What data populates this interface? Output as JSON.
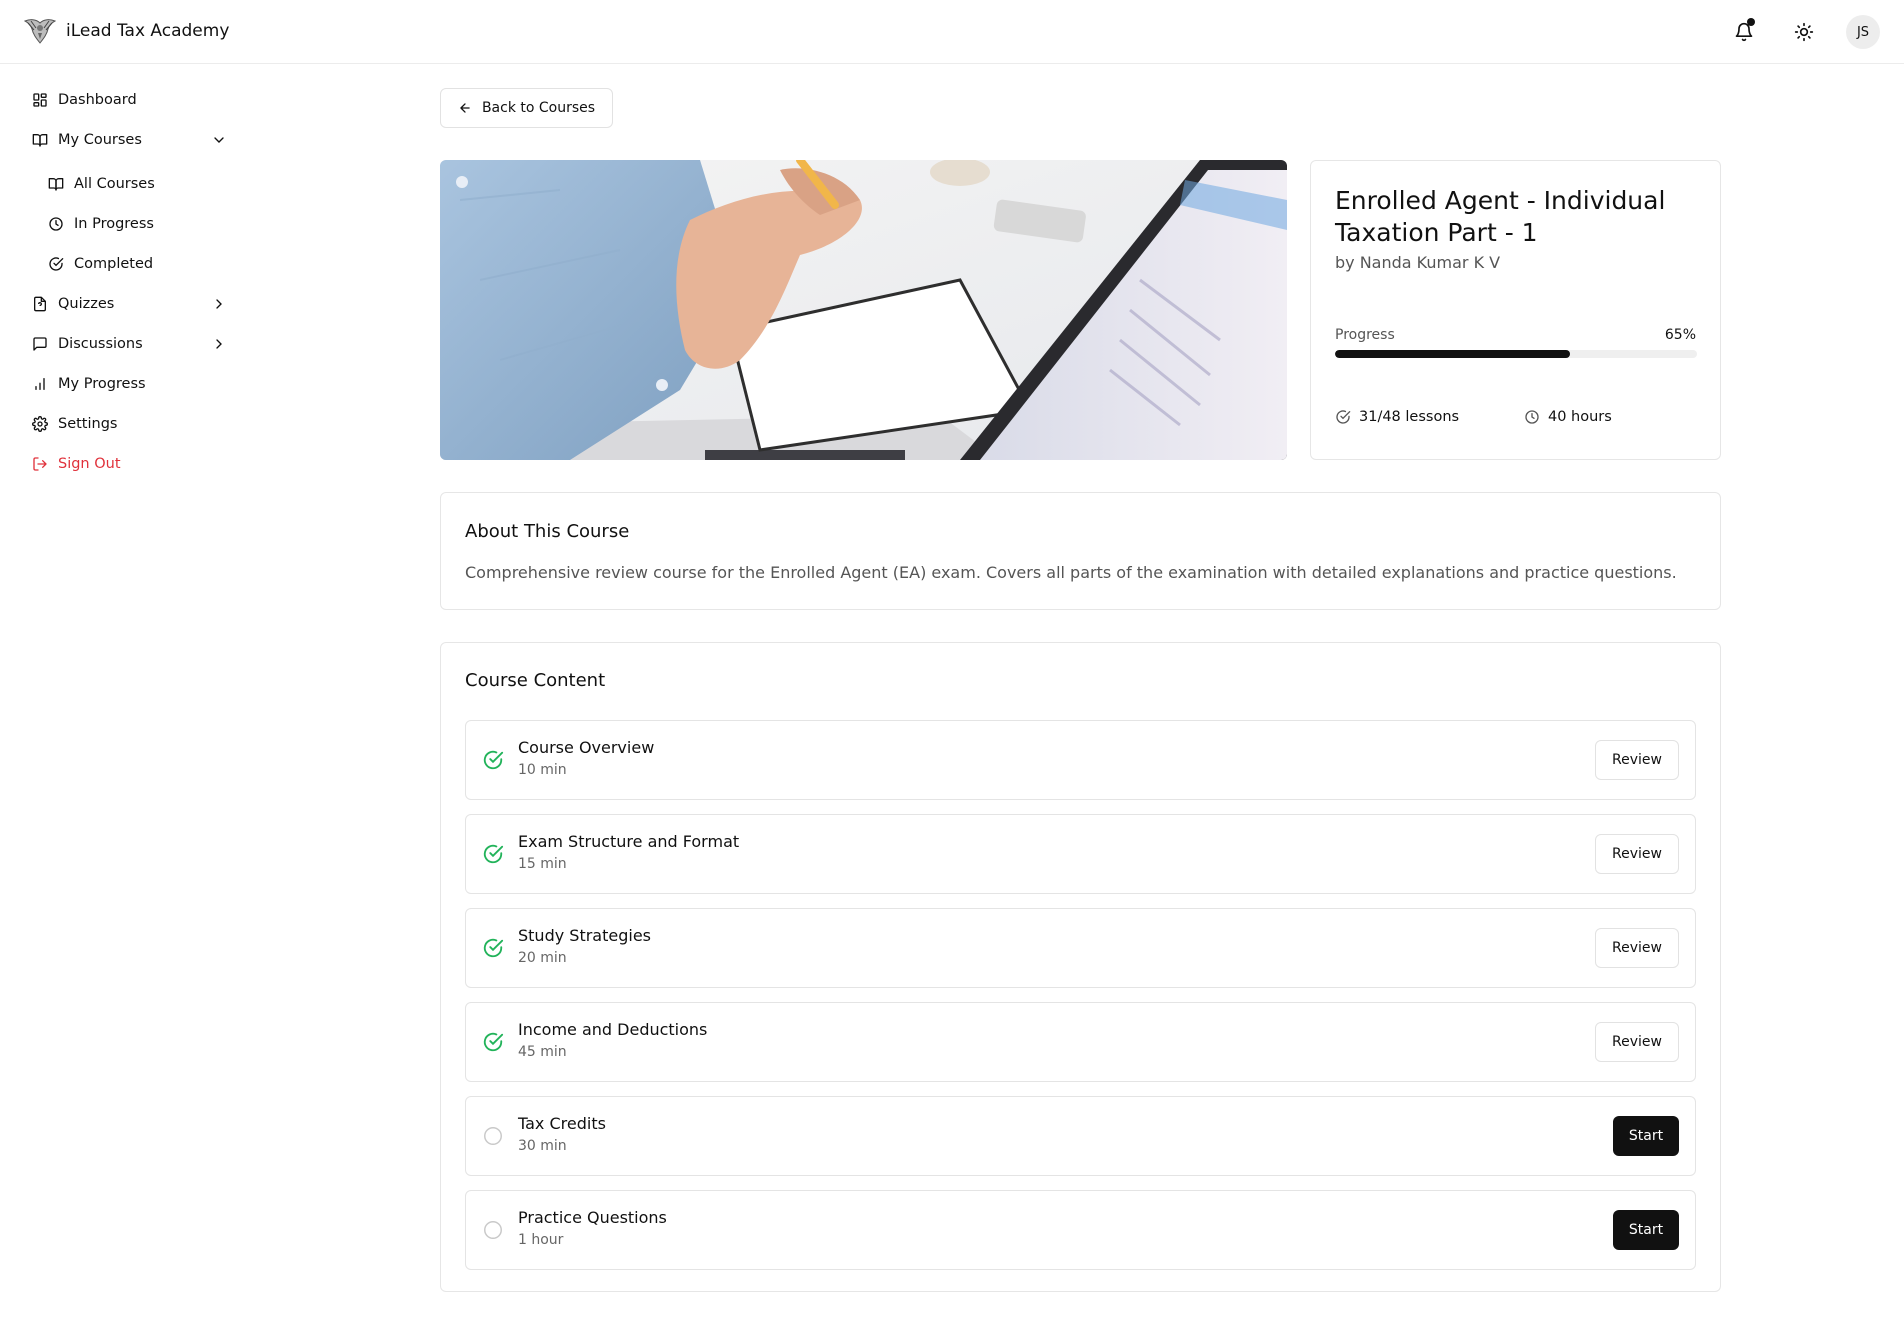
{
  "header": {
    "app_name": "iLead Tax Academy",
    "user_initials": "JS",
    "icons": [
      "eagle-logo",
      "bell-icon",
      "sun-icon"
    ]
  },
  "sidebar": {
    "items": [
      {
        "label": "Dashboard",
        "icon": "grid-icon"
      },
      {
        "label": "My Courses",
        "icon": "book-icon",
        "expanded": true
      },
      {
        "label": "All Courses",
        "icon": "book-icon"
      },
      {
        "label": "In Progress",
        "icon": "clock-icon"
      },
      {
        "label": "Completed",
        "icon": "check-circle-icon"
      },
      {
        "label": "Quizzes",
        "icon": "quiz-file-icon"
      },
      {
        "label": "Discussions",
        "icon": "message-icon"
      },
      {
        "label": "My Progress",
        "icon": "bar-chart-icon"
      },
      {
        "label": "Settings",
        "icon": "gear-icon"
      },
      {
        "label": "Sign Out",
        "icon": "sign-out-icon"
      }
    ]
  },
  "main": {
    "back_label": "Back to Courses",
    "course": {
      "title": "Enrolled Agent - Individual Taxation Part - 1",
      "author": "by Nanda Kumar K V",
      "progress_label": "Progress",
      "progress_text": "65%",
      "progress_value": 0.65,
      "lessons_stat": "31/48 lessons",
      "hours_stat": "40 hours"
    },
    "about": {
      "title": "About This Course",
      "text": "Comprehensive review course for the Enrolled Agent (EA) exam. Covers all parts of the examination with detailed explanations and practice questions."
    },
    "content": {
      "title": "Course Content",
      "lessons": [
        {
          "title": "Course Overview",
          "duration": "10 min",
          "completed": true,
          "action": "Review"
        },
        {
          "title": "Exam Structure and Format",
          "duration": "15 min",
          "completed": true,
          "action": "Review"
        },
        {
          "title": "Study Strategies",
          "duration": "20 min",
          "completed": true,
          "action": "Review"
        },
        {
          "title": "Income and Deductions",
          "duration": "45 min",
          "completed": true,
          "action": "Review"
        },
        {
          "title": "Tax Credits",
          "duration": "30 min",
          "completed": false,
          "action": "Start"
        },
        {
          "title": "Practice Questions",
          "duration": "1 hour",
          "completed": false,
          "action": "Start"
        }
      ]
    }
  },
  "colors": {
    "accent": "#111111",
    "success": "#22b35a",
    "danger": "#e0313b",
    "border": "#e6e6e6"
  }
}
